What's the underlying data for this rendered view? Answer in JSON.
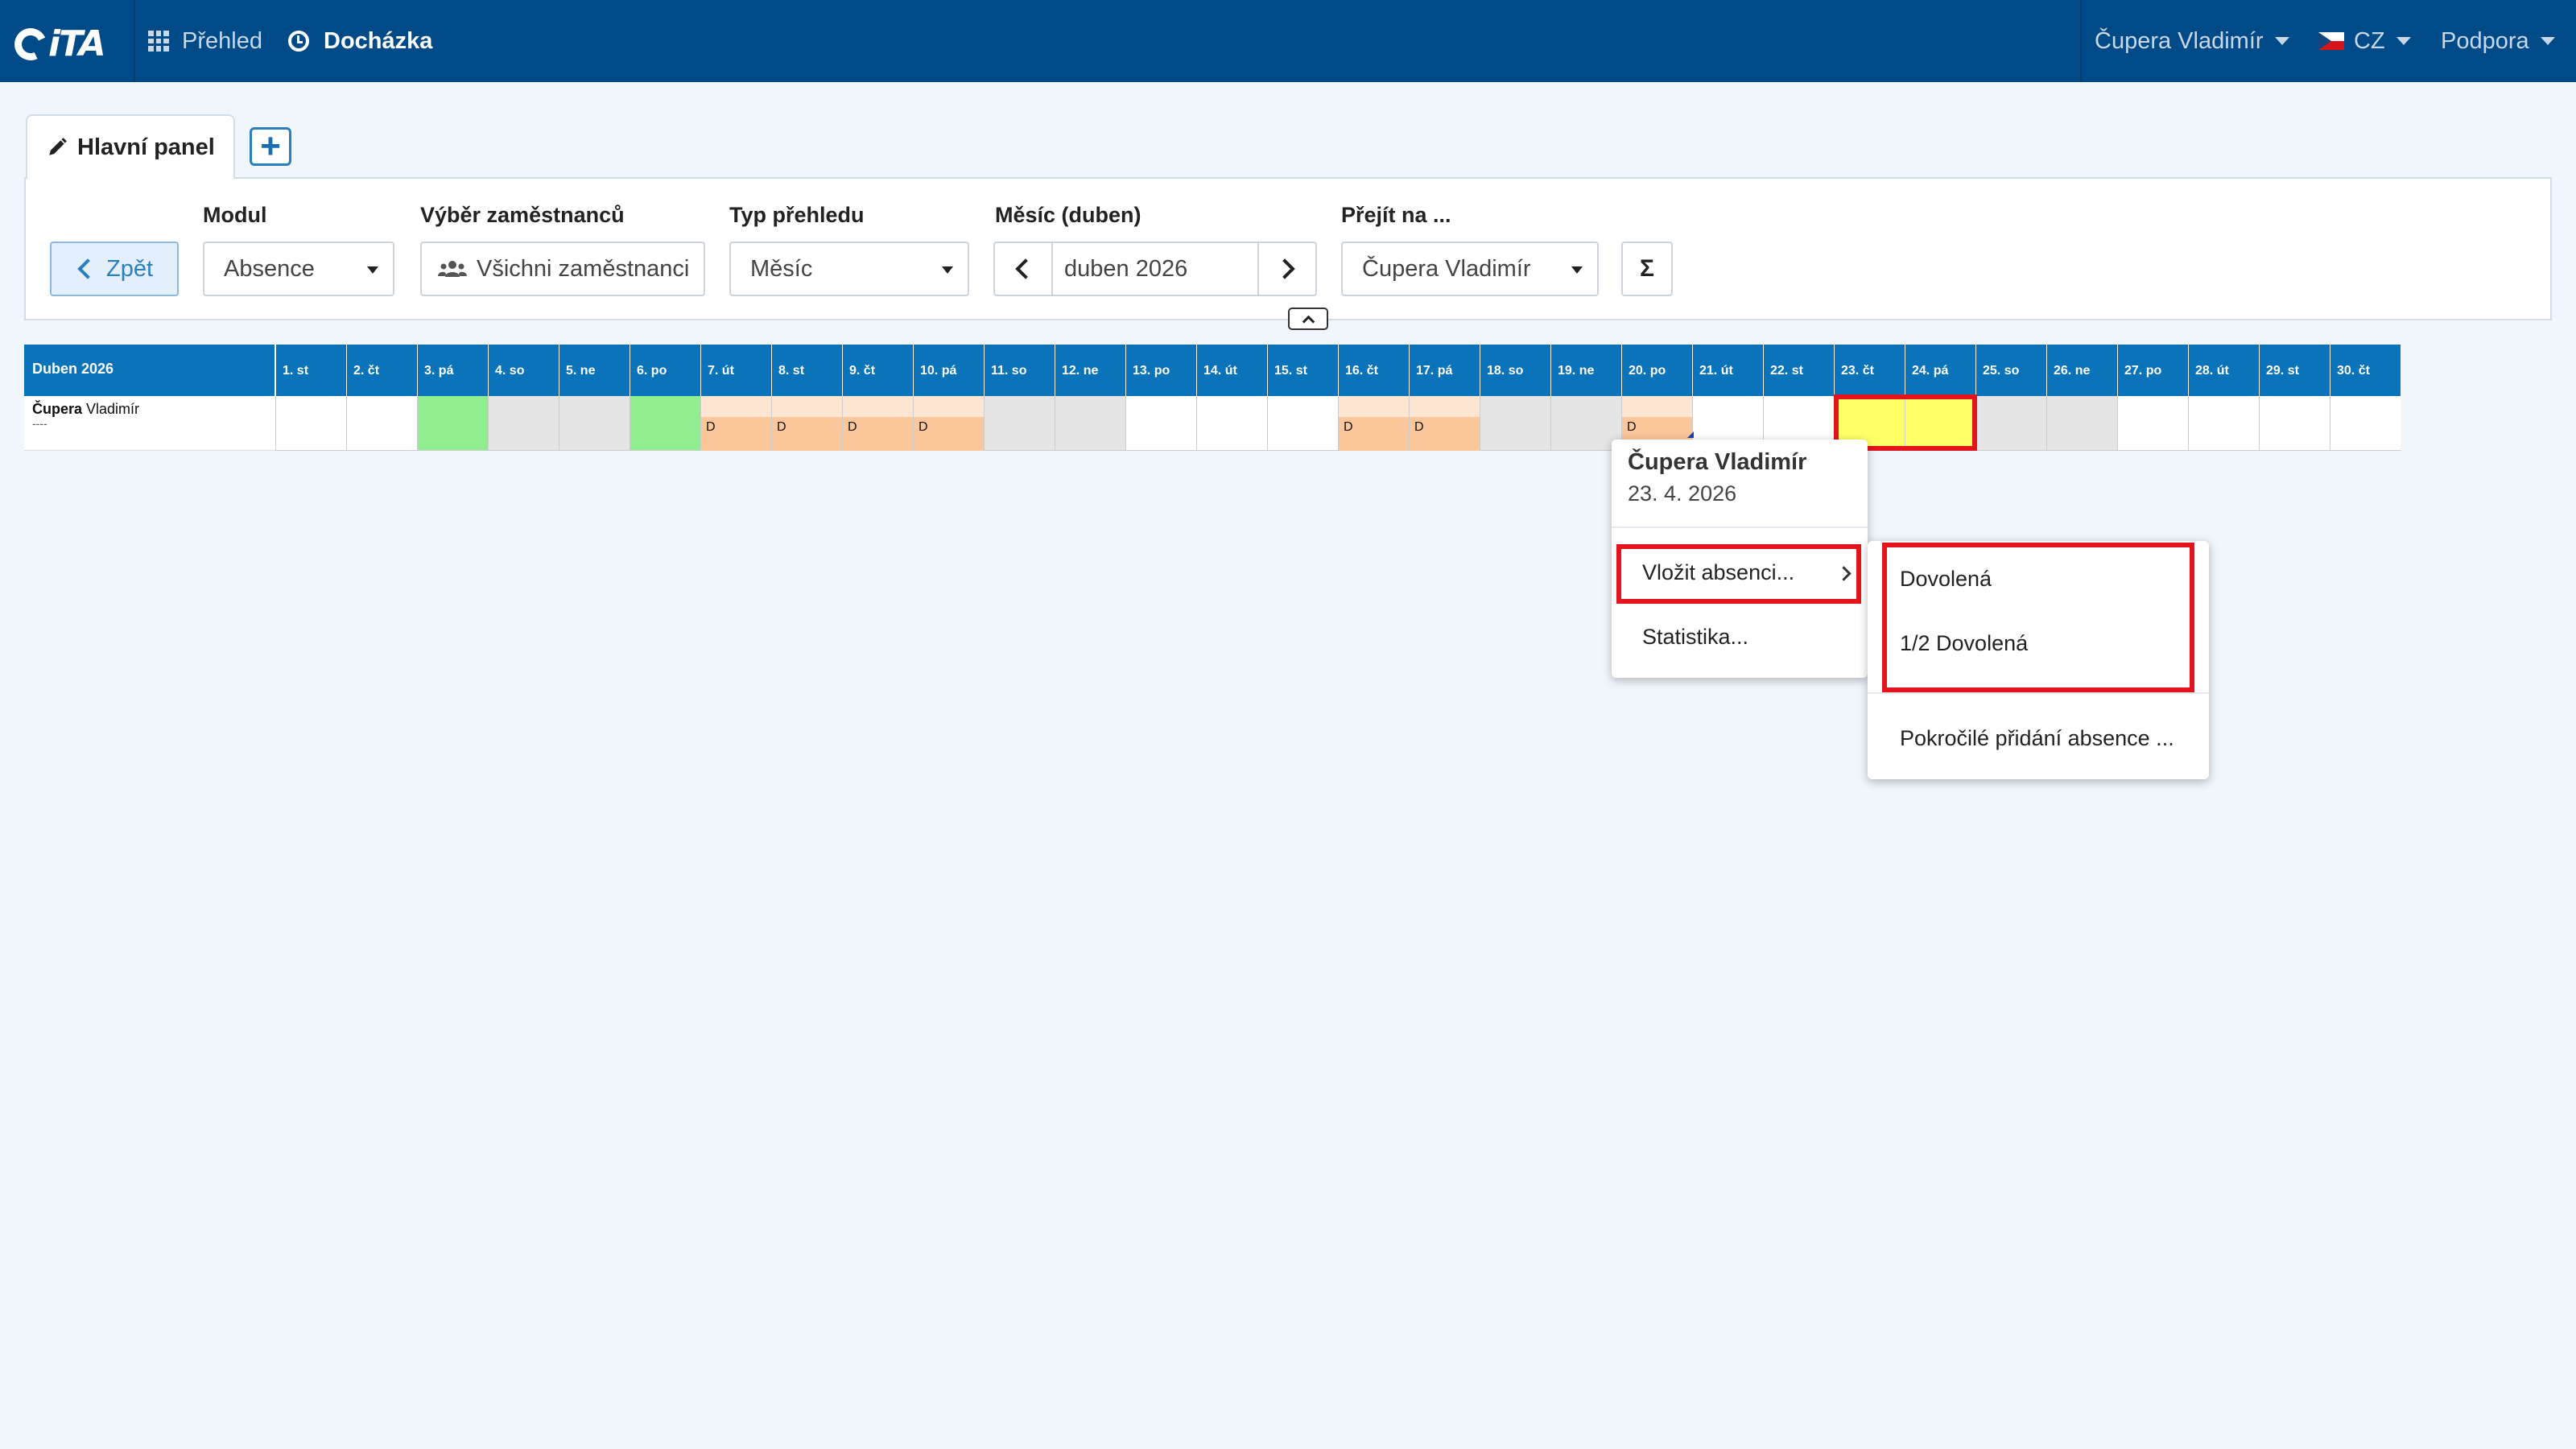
{
  "navbar": {
    "logo_text": "iTA",
    "overview_label": "Přehled",
    "attendance_label": "Docházka",
    "user_menu": "Čupera Vladimír",
    "language": "CZ",
    "support": "Podpora",
    "bg_color": "#004b87"
  },
  "tabs": {
    "main_tab": "Hlavní panel",
    "add_tab": "+"
  },
  "filters": {
    "back_label": "Zpět",
    "module_label": "Modul",
    "module_value": "Absence",
    "employees_label": "Výběr zaměstnanců",
    "employees_value": "Všichni zaměstnanci",
    "view_type_label": "Typ přehledu",
    "view_type_value": "Měsíc",
    "month_label": "Měsíc (duben)",
    "month_value": "duben 2026",
    "goto_label": "Přejít na ...",
    "goto_value": "Čupera Vladimír",
    "sum_button": "Σ"
  },
  "calendar": {
    "title": "Duben 2026",
    "days": [
      "1. st",
      "2. čt",
      "3. pá",
      "4. so",
      "5. ne",
      "6. po",
      "7. út",
      "8. st",
      "9. čt",
      "10. pá",
      "11. so",
      "12. ne",
      "13. po",
      "14. út",
      "15. st",
      "16. čt",
      "17. pá",
      "18. so",
      "19. ne",
      "20. po",
      "21. út",
      "22. st",
      "23. čt",
      "24. pá",
      "25. so",
      "26. ne",
      "27. po",
      "28. út",
      "29. st",
      "30. čt"
    ],
    "employee": {
      "surname": "Čupera",
      "first_name": "Vladimír",
      "sub": "----",
      "cell_states": [
        "empty",
        "empty",
        "holiday",
        "weekend",
        "weekend",
        "holiday",
        "leave",
        "leave",
        "leave",
        "leave",
        "weekend",
        "weekend",
        "empty",
        "empty",
        "empty",
        "leave",
        "leave",
        "weekend",
        "weekend",
        "leave",
        "empty",
        "empty",
        "selected",
        "selected",
        "weekend",
        "weekend",
        "empty",
        "empty",
        "empty",
        "empty"
      ],
      "leave_mark": "D"
    },
    "colors": {
      "header": "#0a73b9",
      "holiday": "#90ee90",
      "weekend": "#e5e5e5",
      "leave": "#fbc79b",
      "selected": "#ffff66",
      "highlight": "#e3141c"
    }
  },
  "context_menu": {
    "name": "Čupera Vladimír",
    "date": "23. 4. 2026",
    "insert_absence": "Vložit absenci...",
    "statistics": "Statistika..."
  },
  "submenu": {
    "vacation": "Dovolená",
    "half_vacation": "1/2 Dovolená",
    "advanced": "Pokročilé přidání absence ..."
  }
}
